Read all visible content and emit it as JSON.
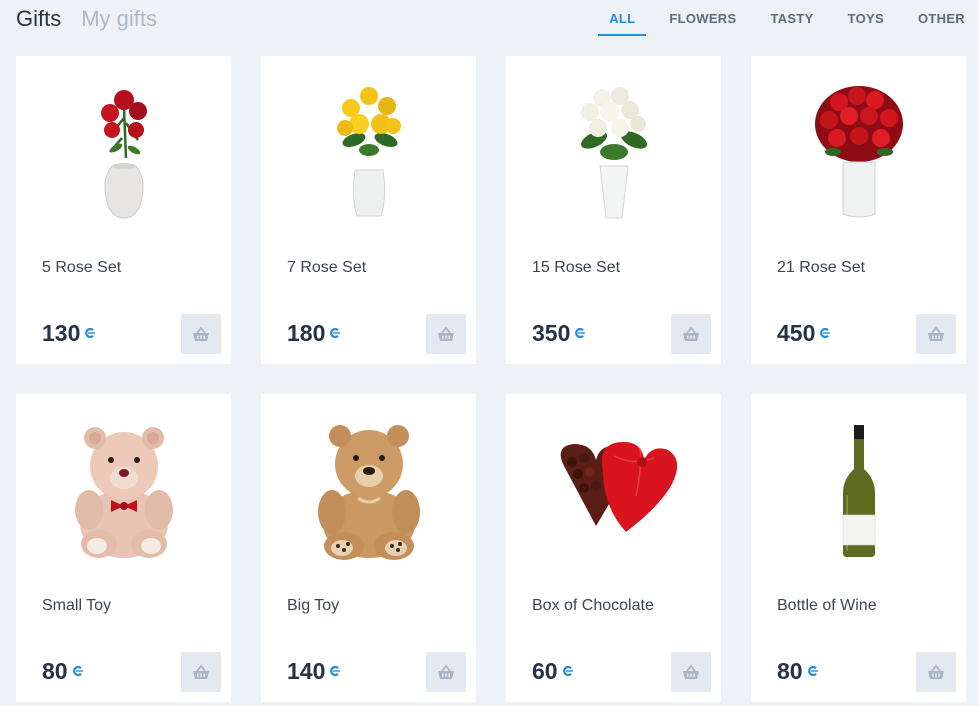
{
  "header": {
    "tabs": [
      {
        "label": "Gifts",
        "active": true
      },
      {
        "label": "My gifts",
        "active": false
      }
    ],
    "categories": [
      {
        "label": "ALL",
        "active": true
      },
      {
        "label": "FLOWERS",
        "active": false
      },
      {
        "label": "TASTY",
        "active": false
      },
      {
        "label": "TOYS",
        "active": false
      },
      {
        "label": "OTHER",
        "active": false
      }
    ]
  },
  "currency_icon": "coin-icon",
  "colors": {
    "accent": "#1f8ee0",
    "background": "#eef2f7",
    "card": "#ffffff",
    "cart_button": "#e4e9f0"
  },
  "gifts": [
    {
      "name": "5 Rose Set",
      "price": "130",
      "image": "rose-vase-small-icon"
    },
    {
      "name": "7 Rose Set",
      "price": "180",
      "image": "yellow-roses-icon"
    },
    {
      "name": "15 Rose Set",
      "price": "350",
      "image": "white-roses-icon"
    },
    {
      "name": "21 Rose Set",
      "price": "450",
      "image": "red-roses-bouquet-icon"
    },
    {
      "name": "Small Toy",
      "price": "80",
      "image": "small-teddy-bear-icon"
    },
    {
      "name": "Big Toy",
      "price": "140",
      "image": "big-teddy-bear-icon"
    },
    {
      "name": "Box of Chocolate",
      "price": "60",
      "image": "chocolate-heart-box-icon"
    },
    {
      "name": "Bottle of Wine",
      "price": "80",
      "image": "wine-bottle-icon"
    }
  ]
}
